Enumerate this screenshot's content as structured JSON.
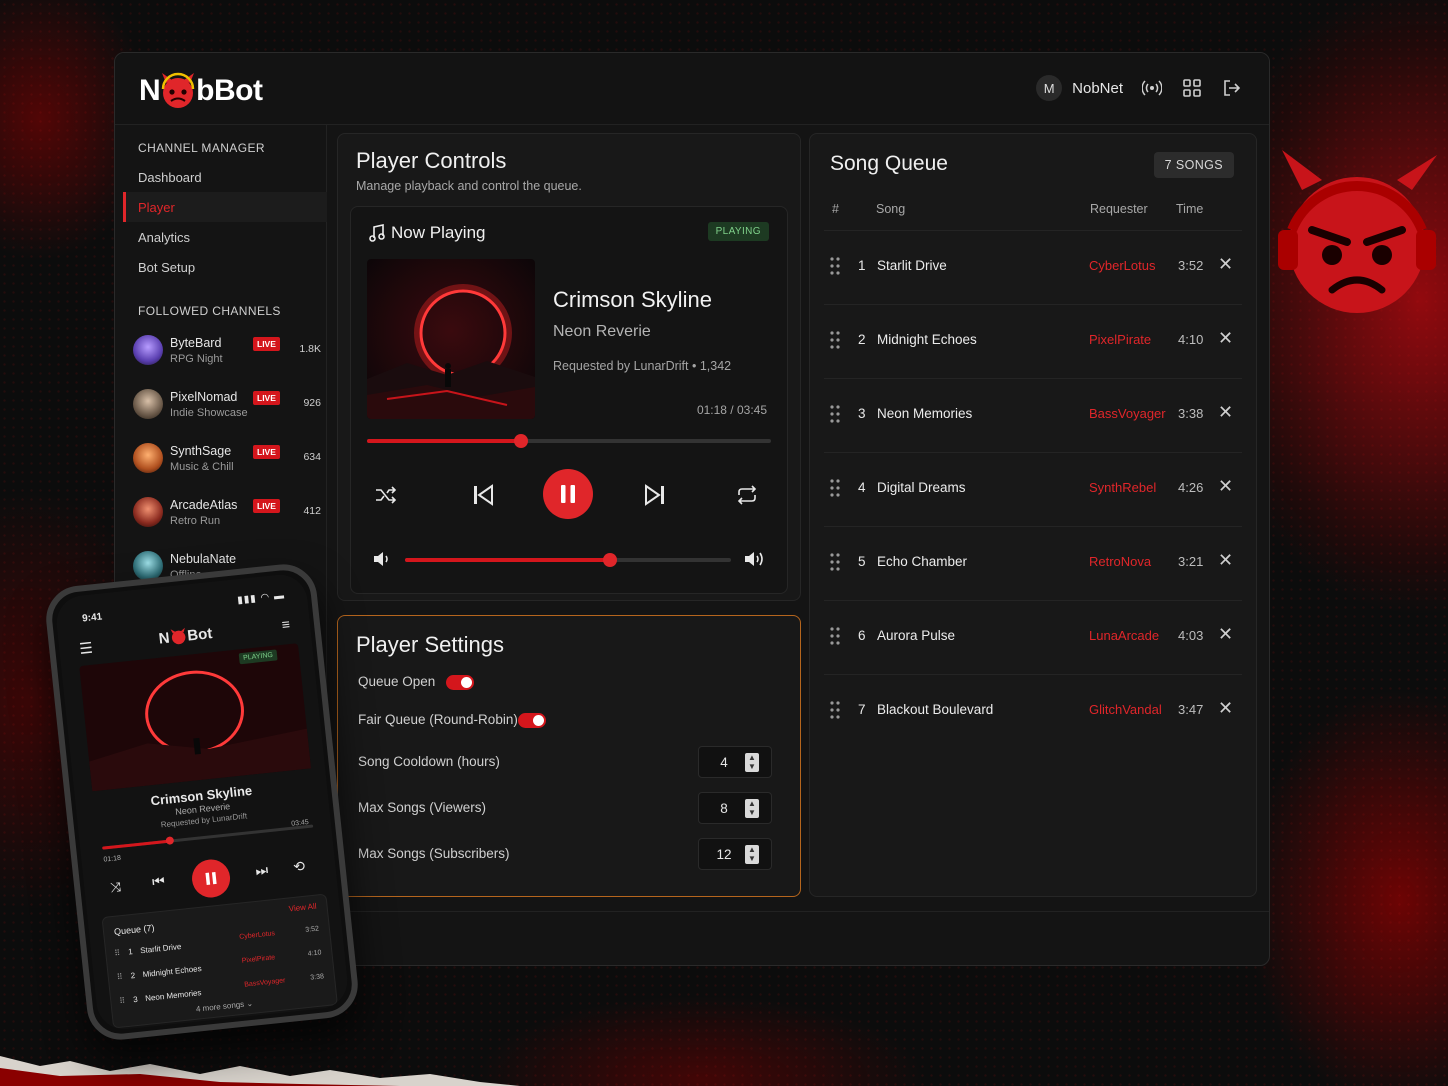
{
  "brand": {
    "name_prefix": "N",
    "name_suffix": "bBot",
    "accent": "#e0262a"
  },
  "topbar": {
    "avatar_initial": "M",
    "user_name": "NobNet",
    "icons": [
      "broadcast-icon",
      "grid-icon",
      "logout-icon"
    ]
  },
  "sidebar": {
    "channel_manager_heading": "CHANNEL MANAGER",
    "items": [
      {
        "label": "Dashboard",
        "active": false
      },
      {
        "label": "Player",
        "active": true
      },
      {
        "label": "Analytics",
        "active": false
      },
      {
        "label": "Bot Setup",
        "active": false
      }
    ],
    "followed_heading": "FOLLOWED CHANNELS",
    "followed": [
      {
        "name": "ByteBard",
        "sub": "RPG Night",
        "live": "LIVE",
        "count": "1.8K",
        "color": "#5a3fb0"
      },
      {
        "name": "PixelNomad",
        "sub": "Indie Showcase",
        "live": "LIVE",
        "count": "926",
        "color": "#6b5a4a"
      },
      {
        "name": "SynthSage",
        "sub": "Music & Chill",
        "live": "LIVE",
        "count": "634",
        "color": "#b0501f"
      },
      {
        "name": "ArcadeAtlas",
        "sub": "Retro Run",
        "live": "LIVE",
        "count": "412",
        "color": "#8a2a1f"
      },
      {
        "name": "NebulaNate",
        "sub": "Offline",
        "live": "",
        "count": "",
        "color": "#2f6f78"
      }
    ]
  },
  "player_controls": {
    "title": "Player Controls",
    "subtitle": "Manage playback and control the queue.",
    "now_playing_label": "Now Playing",
    "status_badge": "PLAYING",
    "song_title": "Crimson Skyline",
    "artist": "Neon Reverie",
    "requested": "Requested by LunarDrift • 1,342",
    "time_display": "01:18 / 03:45",
    "progress": 0.38,
    "volume": 0.63
  },
  "player_settings": {
    "title": "Player Settings",
    "queue_open_label": "Queue Open",
    "queue_open": true,
    "fair_queue_label": "Fair Queue (Round-Robin)",
    "fair_queue": true,
    "cooldown_label": "Song Cooldown (hours)",
    "cooldown_value": "4",
    "max_viewers_label": "Max Songs (Viewers)",
    "max_viewers_value": "8",
    "max_subs_label": "Max Songs (Subscribers)",
    "max_subs_value": "12"
  },
  "song_queue": {
    "title": "Song Queue",
    "count_badge": "7 SONGS",
    "headers": {
      "num": "#",
      "song": "Song",
      "requester": "Requester",
      "time": "Time"
    },
    "rows": [
      {
        "num": "1",
        "song": "Starlit Drive",
        "requester": "CyberLotus",
        "time": "3:52"
      },
      {
        "num": "2",
        "song": "Midnight Echoes",
        "requester": "PixelPirate",
        "time": "4:10"
      },
      {
        "num": "3",
        "song": "Neon Memories",
        "requester": "BassVoyager",
        "time": "3:38"
      },
      {
        "num": "4",
        "song": "Digital Dreams",
        "requester": "SynthRebel",
        "time": "4:26"
      },
      {
        "num": "5",
        "song": "Echo Chamber",
        "requester": "RetroNova",
        "time": "3:21"
      },
      {
        "num": "6",
        "song": "Aurora Pulse",
        "requester": "LunaArcade",
        "time": "4:03"
      },
      {
        "num": "7",
        "song": "Blackout Boulevard",
        "requester": "GlitchVandal",
        "time": "3:47"
      }
    ]
  },
  "phone": {
    "clock": "9:41",
    "brand_prefix": "N",
    "brand_suffix": "Bot",
    "status_badge": "PLAYING",
    "song_title": "Crimson Skyline",
    "artist": "Neon Reverie",
    "requested": "Requested by LunarDrift",
    "elapsed": "01:18",
    "total": "03:45",
    "progress": 0.32,
    "queue_label": "Queue (7)",
    "view_all": "View All",
    "rows": [
      {
        "num": "1",
        "song": "Starlit Drive",
        "requester": "CyberLotus",
        "time": "3:52"
      },
      {
        "num": "2",
        "song": "Midnight Echoes",
        "requester": "PixelPirate",
        "time": "4:10"
      },
      {
        "num": "3",
        "song": "Neon Memories",
        "requester": "BassVoyager",
        "time": "3:38"
      }
    ],
    "more": "4 more songs"
  }
}
